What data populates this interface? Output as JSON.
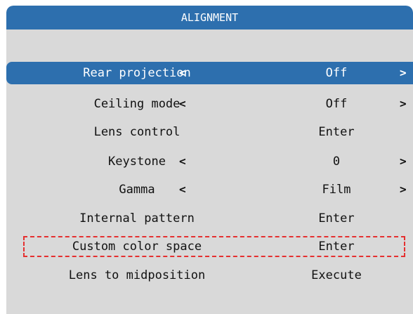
{
  "title": "ALIGNMENT",
  "colors": {
    "accent": "#2d6fae",
    "panel": "#d9d9d9",
    "highlight": "#e53030"
  },
  "icons": {
    "left": "chevron-left-icon",
    "right": "chevron-right-icon"
  },
  "arrow_left": "<",
  "arrow_right": ">",
  "items": [
    {
      "label": "Rear projection",
      "value": "Off",
      "arrows": true,
      "selected": true
    },
    {
      "label": "Ceiling mode",
      "value": "Off",
      "arrows": true
    },
    {
      "label": "Lens control",
      "value": "Enter",
      "arrows": false
    },
    {
      "label": "Keystone",
      "value": "0",
      "arrows": true
    },
    {
      "label": "Gamma",
      "value": "Film",
      "arrows": true
    },
    {
      "label": "Internal pattern",
      "value": "Enter",
      "arrows": false
    },
    {
      "label": "Custom color space",
      "value": "Enter",
      "arrows": false,
      "highlighted": true
    },
    {
      "label": "Lens to midposition",
      "value": "Execute",
      "arrows": false
    }
  ]
}
